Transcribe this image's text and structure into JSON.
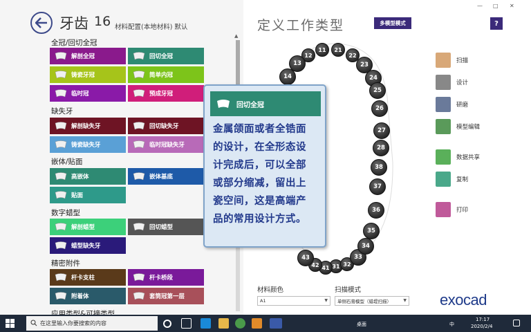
{
  "header": {
    "title": "牙齿",
    "number": "16",
    "subtitle": "材料配置(本地材料) 默认"
  },
  "categories": [
    {
      "label": "全冠/回切全冠"
    },
    {
      "label": "缺失牙"
    },
    {
      "label": "嵌体/贴面"
    },
    {
      "label": "数字蜡型"
    },
    {
      "label": "精密附件"
    },
    {
      "label": "应用类型&可摘类型"
    }
  ],
  "tiles": [
    {
      "label": "解剖全冠",
      "color": "#8a1a8c"
    },
    {
      "label": "回切全冠",
      "color": "#2e8a73"
    },
    {
      "label": "铸瓷牙冠",
      "color": "#a6c41a"
    },
    {
      "label": "简单内冠",
      "color": "#7dc41a"
    },
    {
      "label": "临时冠",
      "color": "#8a1aa8"
    },
    {
      "label": "预成牙冠",
      "color": "#d01e7a"
    },
    {
      "label": "解剖缺失牙",
      "color": "#6e1424"
    },
    {
      "label": "回切缺失牙",
      "color": "#6e1424"
    },
    {
      "label": "铸瓷缺失牙",
      "color": "#5aa0d6"
    },
    {
      "label": "临时冠缺失牙",
      "color": "#b86ab8"
    },
    {
      "label": "高嵌体",
      "color": "#2e8a73"
    },
    {
      "label": "嵌体基底",
      "color": "#1e5aa8"
    },
    {
      "label": "贴面",
      "color": "#2e9a8a"
    },
    {
      "label": "解剖蜡型",
      "color": "#3cd07a"
    },
    {
      "label": "回切蜡型",
      "color": "#555555"
    },
    {
      "label": "蜡型缺失牙",
      "color": "#2a1a7a"
    },
    {
      "label": "杆卡支柱",
      "color": "#5a3a1a"
    },
    {
      "label": "杆卡桥段",
      "color": "#7a1a9a"
    },
    {
      "label": "附着体",
      "color": "#2a5a6a"
    },
    {
      "label": "套筒冠第一层",
      "color": "#a8505a"
    }
  ],
  "right_panel": {
    "title": "定义工作类型",
    "multi_button": "多模型模式",
    "help": "?",
    "tooltip_title": "回切全冠",
    "tooltip_lines": [
      "金属颌面或者全锆面",
      "的设计，在全形态设",
      "计完成后，可以全部",
      "或部分缩减，留出上",
      "瓷空间，这是高端产",
      "品的常用设计方式。"
    ],
    "material_label": "材料颜色",
    "material_value": "A1",
    "scan_label": "扫描模式",
    "scan_value": "单侧石膏模型（蜡堤扫描）",
    "logo": "exocad"
  },
  "sidebar": [
    {
      "label": "扫描",
      "color": "#d8a878"
    },
    {
      "label": "设计",
      "color": "#888888"
    },
    {
      "label": "研磨",
      "color": "#6a7a9a"
    },
    {
      "label": "模型编辑",
      "color": "#5a9a5a"
    },
    {
      "label": "数据共享",
      "color": "#5ab05a"
    },
    {
      "label": "复制",
      "color": "#4aa88a"
    },
    {
      "label": "打印",
      "color": "#c05a9a"
    }
  ],
  "teeth_upper": [
    "11",
    "12",
    "13",
    "14",
    "21",
    "22",
    "23",
    "24",
    "25",
    "26",
    "27",
    "28"
  ],
  "teeth_lower": [
    "31",
    "32",
    "33",
    "34",
    "35",
    "36",
    "37",
    "38",
    "41",
    "42",
    "43"
  ],
  "window_controls": {
    "minimize": "—",
    "maximize": "□",
    "close": "✕"
  },
  "taskbar": {
    "search_placeholder": "在这里输入你要搜索的内容",
    "desktop": "桌面",
    "time": "17:17",
    "date": "2020/2/4",
    "lang": "中"
  }
}
